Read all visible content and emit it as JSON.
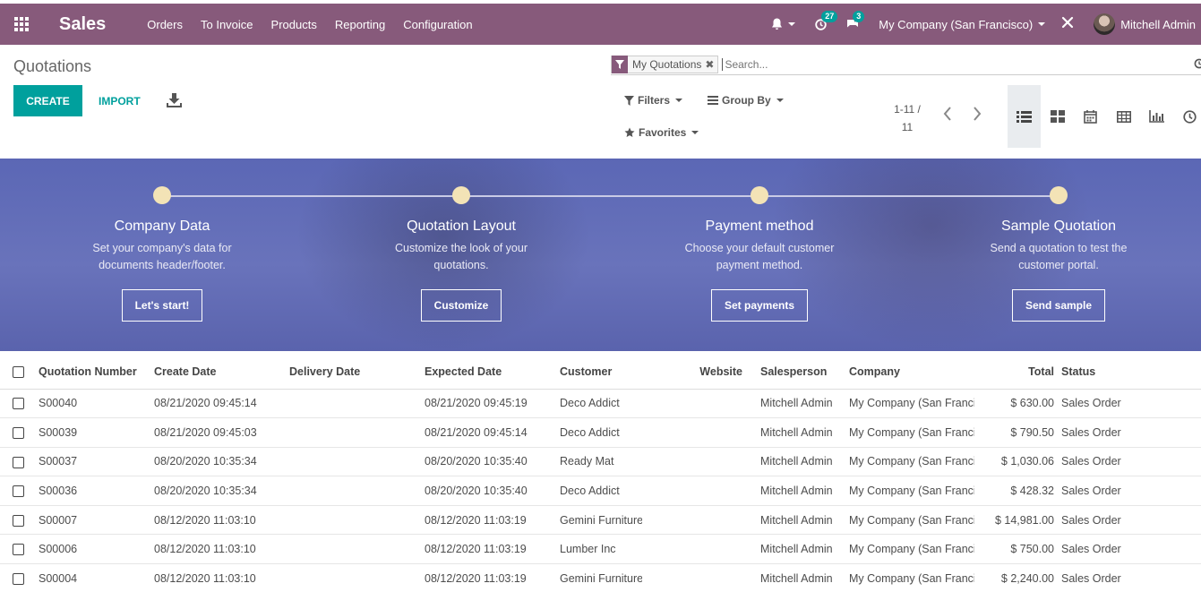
{
  "navbar": {
    "app_title": "Sales",
    "menu": [
      "Orders",
      "To Invoice",
      "Products",
      "Reporting",
      "Configuration"
    ],
    "activity_count": "27",
    "message_count": "3",
    "company": "My Company (San Francisco)",
    "user": "Mitchell Admin"
  },
  "control_panel": {
    "breadcrumb": "Quotations",
    "create_label": "CREATE",
    "import_label": "IMPORT",
    "facet_label": "My Quotations",
    "search_placeholder": "Search...",
    "filters_label": "Filters",
    "groupby_label": "Group By",
    "favorites_label": "Favorites",
    "pager_range": "1-11 /",
    "pager_total": "11"
  },
  "onboarding": {
    "steps": [
      {
        "title": "Company Data",
        "desc1": "Set your company's data for",
        "desc2": "documents header/footer.",
        "button": "Let's start!"
      },
      {
        "title": "Quotation Layout",
        "desc1": "Customize the look of your",
        "desc2": "quotations.",
        "button": "Customize"
      },
      {
        "title": "Payment method",
        "desc1": "Choose your default customer",
        "desc2": "payment method.",
        "button": "Set payments"
      },
      {
        "title": "Sample Quotation",
        "desc1": "Send a quotation to test the",
        "desc2": "customer portal.",
        "button": "Send sample"
      }
    ]
  },
  "table": {
    "headers": {
      "number": "Quotation Number",
      "create_date": "Create Date",
      "delivery_date": "Delivery Date",
      "expected_date": "Expected Date",
      "customer": "Customer",
      "website": "Website",
      "salesperson": "Salesperson",
      "company": "Company",
      "total": "Total",
      "status": "Status"
    },
    "rows": [
      {
        "number": "S00040",
        "create_date": "08/21/2020 09:45:14",
        "delivery_date": "",
        "expected_date": "08/21/2020 09:45:19",
        "customer": "Deco Addict",
        "website": "",
        "salesperson": "Mitchell Admin",
        "company": "My Company (San Francisco)",
        "total": "$ 630.00",
        "status": "Sales Order"
      },
      {
        "number": "S00039",
        "create_date": "08/21/2020 09:45:03",
        "delivery_date": "",
        "expected_date": "08/21/2020 09:45:14",
        "customer": "Deco Addict",
        "website": "",
        "salesperson": "Mitchell Admin",
        "company": "My Company (San Francisco)",
        "total": "$ 790.50",
        "status": "Sales Order"
      },
      {
        "number": "S00037",
        "create_date": "08/20/2020 10:35:34",
        "delivery_date": "",
        "expected_date": "08/20/2020 10:35:40",
        "customer": "Ready Mat",
        "website": "",
        "salesperson": "Mitchell Admin",
        "company": "My Company (San Francisco)",
        "total": "$ 1,030.06",
        "status": "Sales Order"
      },
      {
        "number": "S00036",
        "create_date": "08/20/2020 10:35:34",
        "delivery_date": "",
        "expected_date": "08/20/2020 10:35:40",
        "customer": "Deco Addict",
        "website": "",
        "salesperson": "Mitchell Admin",
        "company": "My Company (San Francisco)",
        "total": "$ 428.32",
        "status": "Sales Order"
      },
      {
        "number": "S00007",
        "create_date": "08/12/2020 11:03:10",
        "delivery_date": "",
        "expected_date": "08/12/2020 11:03:19",
        "customer": "Gemini Furniture",
        "website": "",
        "salesperson": "Mitchell Admin",
        "company": "My Company (San Francisco)",
        "total": "$ 14,981.00",
        "status": "Sales Order"
      },
      {
        "number": "S00006",
        "create_date": "08/12/2020 11:03:10",
        "delivery_date": "",
        "expected_date": "08/12/2020 11:03:19",
        "customer": "Lumber Inc",
        "website": "",
        "salesperson": "Mitchell Admin",
        "company": "My Company (San Francisco)",
        "total": "$ 750.00",
        "status": "Sales Order"
      },
      {
        "number": "S00004",
        "create_date": "08/12/2020 11:03:10",
        "delivery_date": "",
        "expected_date": "08/12/2020 11:03:19",
        "customer": "Gemini Furniture",
        "website": "",
        "salesperson": "Mitchell Admin",
        "company": "My Company (San Francisco)",
        "total": "$ 2,240.00",
        "status": "Sales Order"
      }
    ]
  },
  "colors": {
    "brand": "#875a7b",
    "accent": "#00a09d",
    "banner": "#6470b8"
  }
}
